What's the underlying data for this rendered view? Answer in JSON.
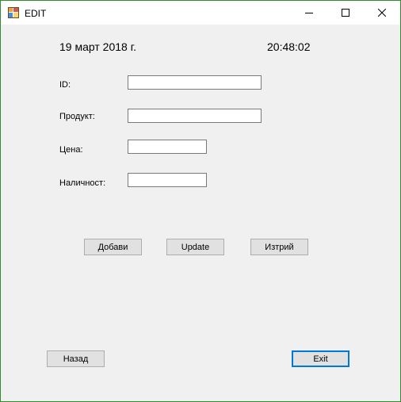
{
  "window": {
    "title": "EDIT"
  },
  "header": {
    "date": "19 март 2018 г.",
    "time": "20:48:02"
  },
  "form": {
    "id_label": "ID:",
    "id_value": "",
    "product_label": "Продукт:",
    "product_value": "",
    "price_label": "Цена:",
    "price_value": "",
    "stock_label": "Наличност:",
    "stock_value": ""
  },
  "actions": {
    "add_label": "Добави",
    "update_label": "Update",
    "delete_label": "Изтрий"
  },
  "footer": {
    "back_label": "Назад",
    "exit_label": "Exit"
  },
  "colors": {
    "frame_border": "#2e8b2e",
    "client_bg": "#f0f0f0",
    "button_bg": "#e1e1e1",
    "focus_accent": "#0078d7"
  }
}
